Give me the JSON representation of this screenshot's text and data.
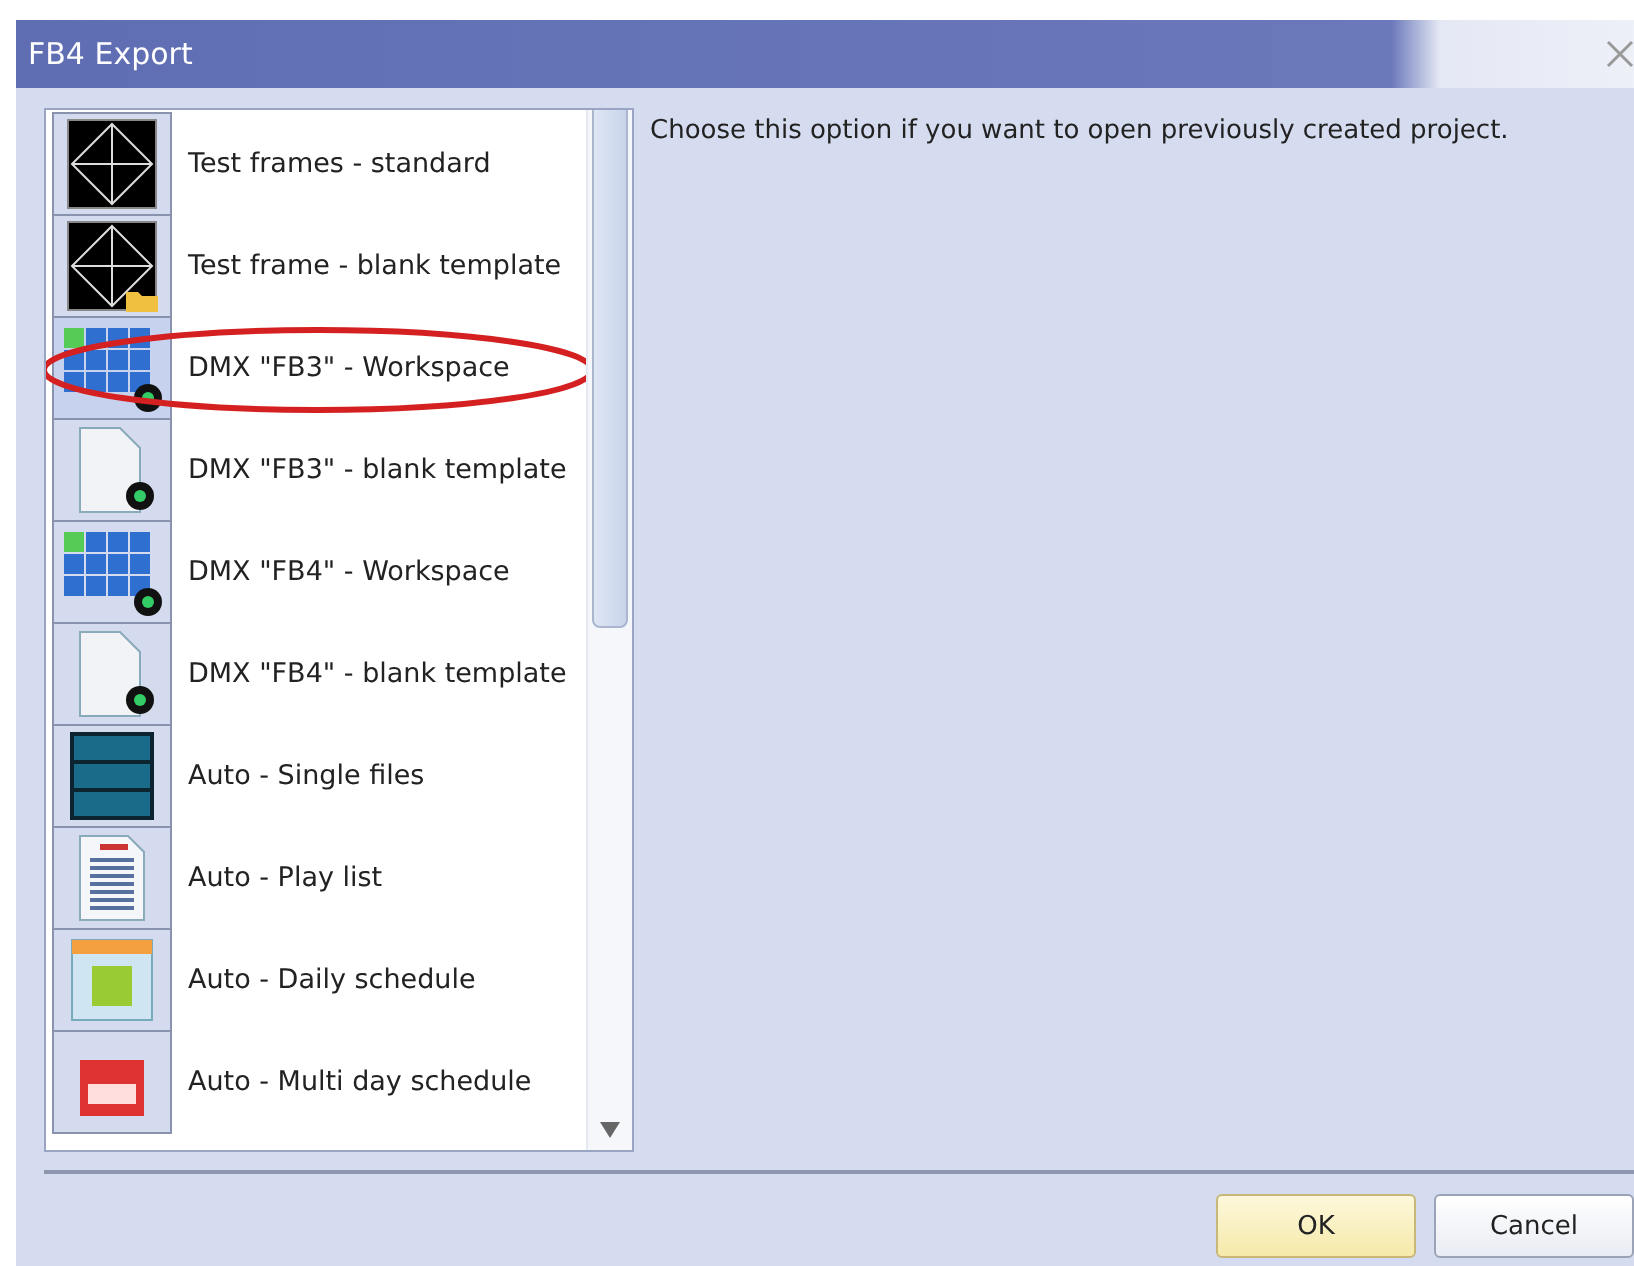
{
  "window": {
    "title": "FB4 Export"
  },
  "options": [
    {
      "label": "Test frames - standard",
      "kind": "frame",
      "selected": false,
      "circled": false
    },
    {
      "label": "Test frame - blank template",
      "kind": "frame-folder",
      "selected": false,
      "circled": false
    },
    {
      "label": "DMX \"FB3\" - Workspace",
      "kind": "grid",
      "selected": true,
      "circled": true
    },
    {
      "label": "DMX \"FB3\" - blank template",
      "kind": "page",
      "selected": false,
      "circled": false
    },
    {
      "label": "DMX \"FB4\" - Workspace",
      "kind": "grid",
      "selected": false,
      "circled": false
    },
    {
      "label": "DMX \"FB4\" - blank template",
      "kind": "page",
      "selected": false,
      "circled": false
    },
    {
      "label": "Auto - Single files",
      "kind": "numbers",
      "selected": false,
      "circled": false
    },
    {
      "label": "Auto - Play list",
      "kind": "list",
      "selected": false,
      "circled": false
    },
    {
      "label": "Auto - Daily schedule",
      "kind": "calendar",
      "selected": false,
      "circled": false
    },
    {
      "label": "Auto - Multi day schedule",
      "kind": "calendar-multi",
      "selected": false,
      "circled": false
    }
  ],
  "description": "Choose this option if you want to open previously created project.",
  "buttons": [
    {
      "label": "OK",
      "kind": "default"
    },
    {
      "label": "Cancel",
      "kind": "normal"
    }
  ]
}
